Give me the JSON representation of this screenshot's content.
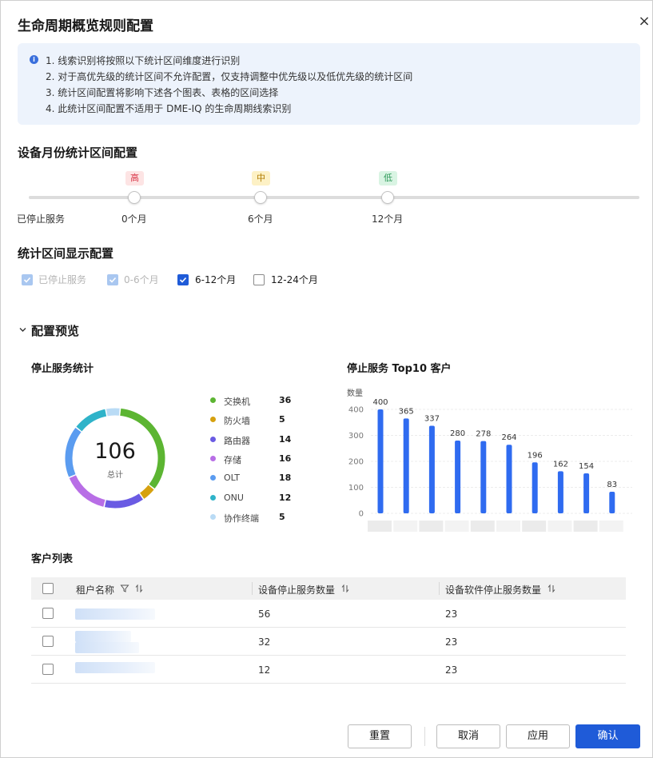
{
  "dialog": {
    "title": "生命周期概览规则配置",
    "close_icon": "×"
  },
  "notice": {
    "icon": "info-icon",
    "lines": [
      "1. 线索识别将按照以下统计区间维度进行识别",
      "2. 对于高优先级的统计区间不允许配置，仅支持调整中优先级以及低优先级的统计区间",
      "3. 统计区间配置将影响下述各个图表、表格的区间选择",
      "4. 此统计区间配置不适用于 DME-IQ 的生命周期线索识别"
    ]
  },
  "month_config": {
    "title": "设备月份统计区间配置",
    "start_label": "已停止服务",
    "points": [
      {
        "tag": "高",
        "label": "0个月"
      },
      {
        "tag": "中",
        "label": "6个月"
      },
      {
        "tag": "低",
        "label": "12个月"
      }
    ]
  },
  "display_config": {
    "title": "统计区间显示配置",
    "options": [
      {
        "label": "已停止服务",
        "checked": true,
        "disabled": true
      },
      {
        "label": "0-6个月",
        "checked": true,
        "disabled": true
      },
      {
        "label": "6-12个月",
        "checked": true,
        "disabled": false
      },
      {
        "label": "12-24个月",
        "checked": false,
        "disabled": false
      }
    ]
  },
  "preview": {
    "title": "配置预览",
    "chevron_icon": "chevron-down-icon",
    "donut": {
      "title": "停止服务统计",
      "total": "106",
      "total_label": "总计",
      "items": [
        {
          "name": "交换机",
          "value": 36,
          "color": "#5cb532"
        },
        {
          "name": "防火墙",
          "value": 5,
          "color": "#d6a10f"
        },
        {
          "name": "路由器",
          "value": 14,
          "color": "#6a5be3"
        },
        {
          "name": "存储",
          "value": 16,
          "color": "#b86ee6"
        },
        {
          "name": "OLT",
          "value": 18,
          "color": "#5b9cf0"
        },
        {
          "name": "ONU",
          "value": 12,
          "color": "#2fb3c9"
        },
        {
          "name": "协作终端",
          "value": 5,
          "color": "#b9dbf5"
        }
      ]
    },
    "bar_title": "停止服务 Top10 客户",
    "table": {
      "title": "客户列表",
      "columns": [
        "租户名称",
        "设备停止服务数量",
        "设备软件停止服务数量"
      ],
      "rows": [
        {
          "device": "56",
          "software": "23"
        },
        {
          "device": "32",
          "software": "23"
        },
        {
          "device": "12",
          "software": "23"
        }
      ]
    }
  },
  "chart_data": {
    "type": "bar",
    "title": "停止服务 Top10 客户",
    "ylabel": "数量",
    "ylim": [
      0,
      400
    ],
    "yticks": [
      "0",
      "100",
      "200",
      "300",
      "400"
    ],
    "values": [
      400,
      365,
      337,
      280,
      278,
      264,
      196,
      162,
      154,
      83
    ],
    "color": "#2f6bf0",
    "grid": true
  },
  "footer": {
    "reset": "重置",
    "cancel": "取消",
    "apply": "应用",
    "confirm": "确认"
  }
}
